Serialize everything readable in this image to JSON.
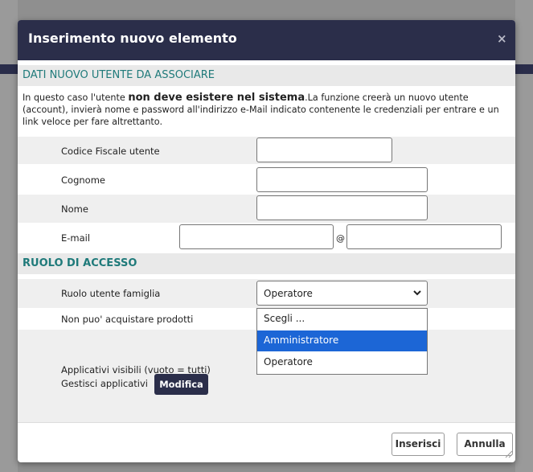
{
  "dialog": {
    "title": "Inserimento nuovo elemento",
    "close_symbol": "×"
  },
  "section_user": {
    "heading": "DATI NUOVO UTENTE DA ASSOCIARE",
    "info_prefix": "In questo caso l'utente ",
    "info_bold": "non deve esistere nel sistema",
    "info_suffix": ".La funzione creerà un nuovo utente (account), invierà nome e password all'indirizzo e-Mail indicato contenente le credenziali per entrare e un link veloce per fare altrettanto.",
    "fields": {
      "codice_fiscale": {
        "label": "Codice Fiscale utente",
        "value": ""
      },
      "cognome": {
        "label": "Cognome",
        "value": ""
      },
      "nome": {
        "label": "Nome",
        "value": ""
      },
      "email": {
        "label": "E-mail",
        "user_value": "",
        "at_symbol": "@",
        "domain_value": ""
      }
    }
  },
  "section_role": {
    "heading": "RUOLO DI ACCESSO",
    "role_label": "Ruolo utente famiglia",
    "role_selected": "Operatore",
    "role_options": [
      "Scegli ...",
      "Amministratore",
      "Operatore"
    ],
    "highlighted_option": "Amministratore",
    "no_purchase_label": "Non puo' acquistare prodotti",
    "apps_visible_label": "Applicativi visibili (vuoto = tutti)",
    "apps_manage_label": "Gestisci applicativi",
    "modify_button": "Modifica"
  },
  "footer": {
    "insert_button": "Inserisci",
    "cancel_button": "Annulla"
  },
  "colors": {
    "titlebar": "#2b2e4a",
    "section_heading_text": "#1f7a7a",
    "highlight": "#1c66d6"
  }
}
